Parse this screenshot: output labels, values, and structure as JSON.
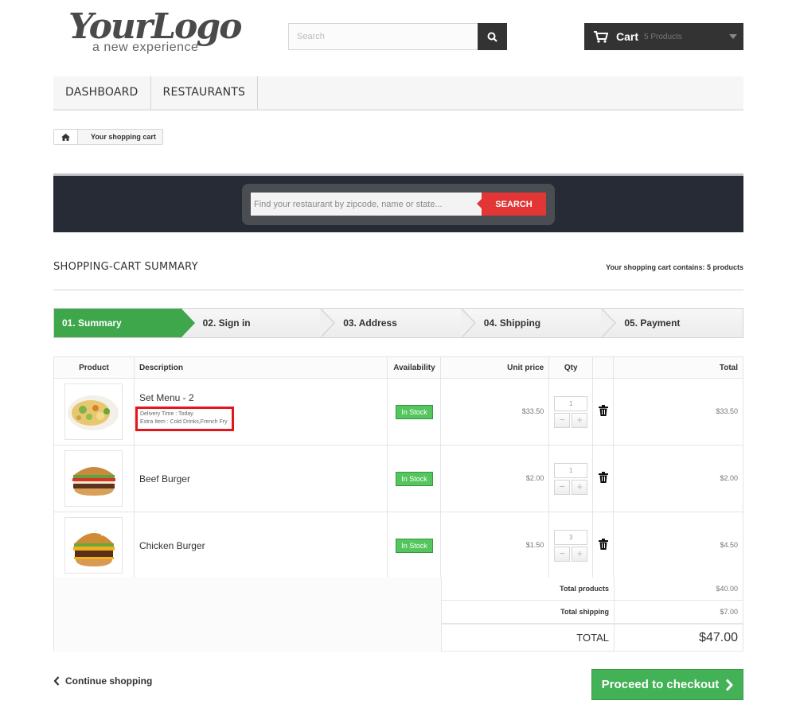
{
  "header": {
    "logo_main": "YourLogo",
    "logo_sub": "a new experience",
    "search_placeholder": "Search",
    "cart_title": "Cart",
    "cart_count": "5 Products"
  },
  "nav": {
    "items": [
      {
        "label": "DASHBOARD"
      },
      {
        "label": "RESTAURANTS"
      }
    ]
  },
  "breadcrumb": {
    "label": "Your shopping cart"
  },
  "banner": {
    "placeholder": "Find your restaurant by zipcode, name or state...",
    "button_label": "SEARCH"
  },
  "summary": {
    "heading": "SHOPPING-CART SUMMARY",
    "count_text": "Your shopping cart contains: 5 products"
  },
  "steps": [
    {
      "label": "01. Summary",
      "active": true
    },
    {
      "label": "02. Sign in",
      "active": false
    },
    {
      "label": "03. Address",
      "active": false
    },
    {
      "label": "04. Shipping",
      "active": false
    },
    {
      "label": "05. Payment",
      "active": false
    }
  ],
  "table": {
    "headers": [
      "Product",
      "Description",
      "Availability",
      "Unit price",
      "Qty",
      "",
      "Total"
    ],
    "rows": [
      {
        "name": "Set Menu - 2",
        "meta1": "Delivery Time : Today",
        "meta2": "Extra Item : Cold Drinks,French Fry",
        "availability": "In Stock",
        "unit_price": "$33.50",
        "qty": "1",
        "total": "$33.50",
        "image": "set-menu-plate"
      },
      {
        "name": "Beef Burger",
        "availability": "In Stock",
        "unit_price": "$2.00",
        "qty": "1",
        "total": "$2.00",
        "image": "beef-burger"
      },
      {
        "name": "Chicken Burger",
        "availability": "In Stock",
        "unit_price": "$1.50",
        "qty": "3",
        "total": "$4.50",
        "image": "chicken-burger"
      }
    ],
    "qty_minus": "−",
    "qty_plus": "+",
    "totals": {
      "products_label": "Total products",
      "products_value": "$40.00",
      "shipping_label": "Total shipping",
      "shipping_value": "$7.00",
      "total_label": "TOTAL",
      "total_value": "$47.00"
    }
  },
  "actions": {
    "continue_label": "Continue shopping",
    "checkout_label": "Proceed to checkout"
  },
  "colors": {
    "accent_green": "#3ea64b",
    "search_red": "#e13536",
    "highlight_red": "#e3161b",
    "header_dark": "#333333",
    "banner_bg": "#262b36"
  }
}
